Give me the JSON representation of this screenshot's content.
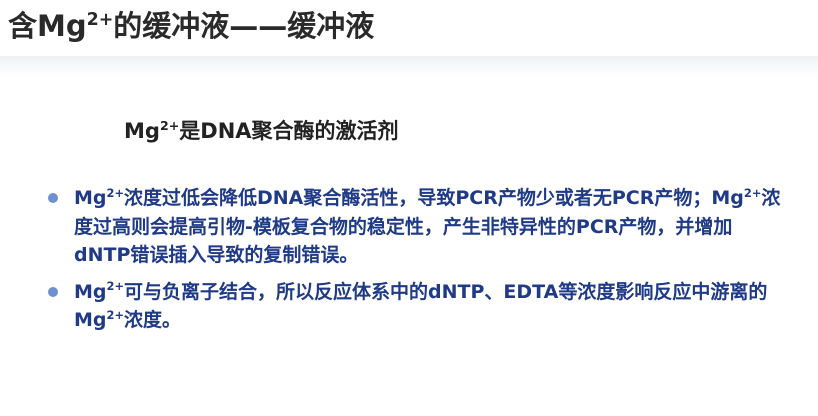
{
  "title": {
    "part1": "含Mg",
    "sup": "2+",
    "part2": "的缓冲液——缓冲液"
  },
  "subtitle": {
    "part1": "Mg",
    "sup": "2+",
    "part2": "是DNA聚合酶的激活剂"
  },
  "bullets": [
    {
      "segments": [
        {
          "text": "Mg"
        },
        {
          "text": "2+",
          "sup": true
        },
        {
          "text": "浓度过低会降低DNA聚合酶活性，导致PCR产物少或者无PCR产物；Mg"
        },
        {
          "text": "2+",
          "sup": true
        },
        {
          "text": "浓度过高则会提高引物-模板复合物的稳定性，产生非特异性的PCR产物，并增加dNTP错误插入导致的复制错误。"
        }
      ]
    },
    {
      "segments": [
        {
          "text": "Mg"
        },
        {
          "text": "2+",
          "sup": true
        },
        {
          "text": "可与负离子结合，所以反应体系中的dNTP、EDTA等浓度影响反应中游离的Mg"
        },
        {
          "text": "2+",
          "sup": true
        },
        {
          "text": "浓度。"
        }
      ]
    }
  ],
  "colors": {
    "title": "#2a2a2a",
    "body_text": "#1f3a86",
    "bullet_dot": "#6f8fd2"
  }
}
